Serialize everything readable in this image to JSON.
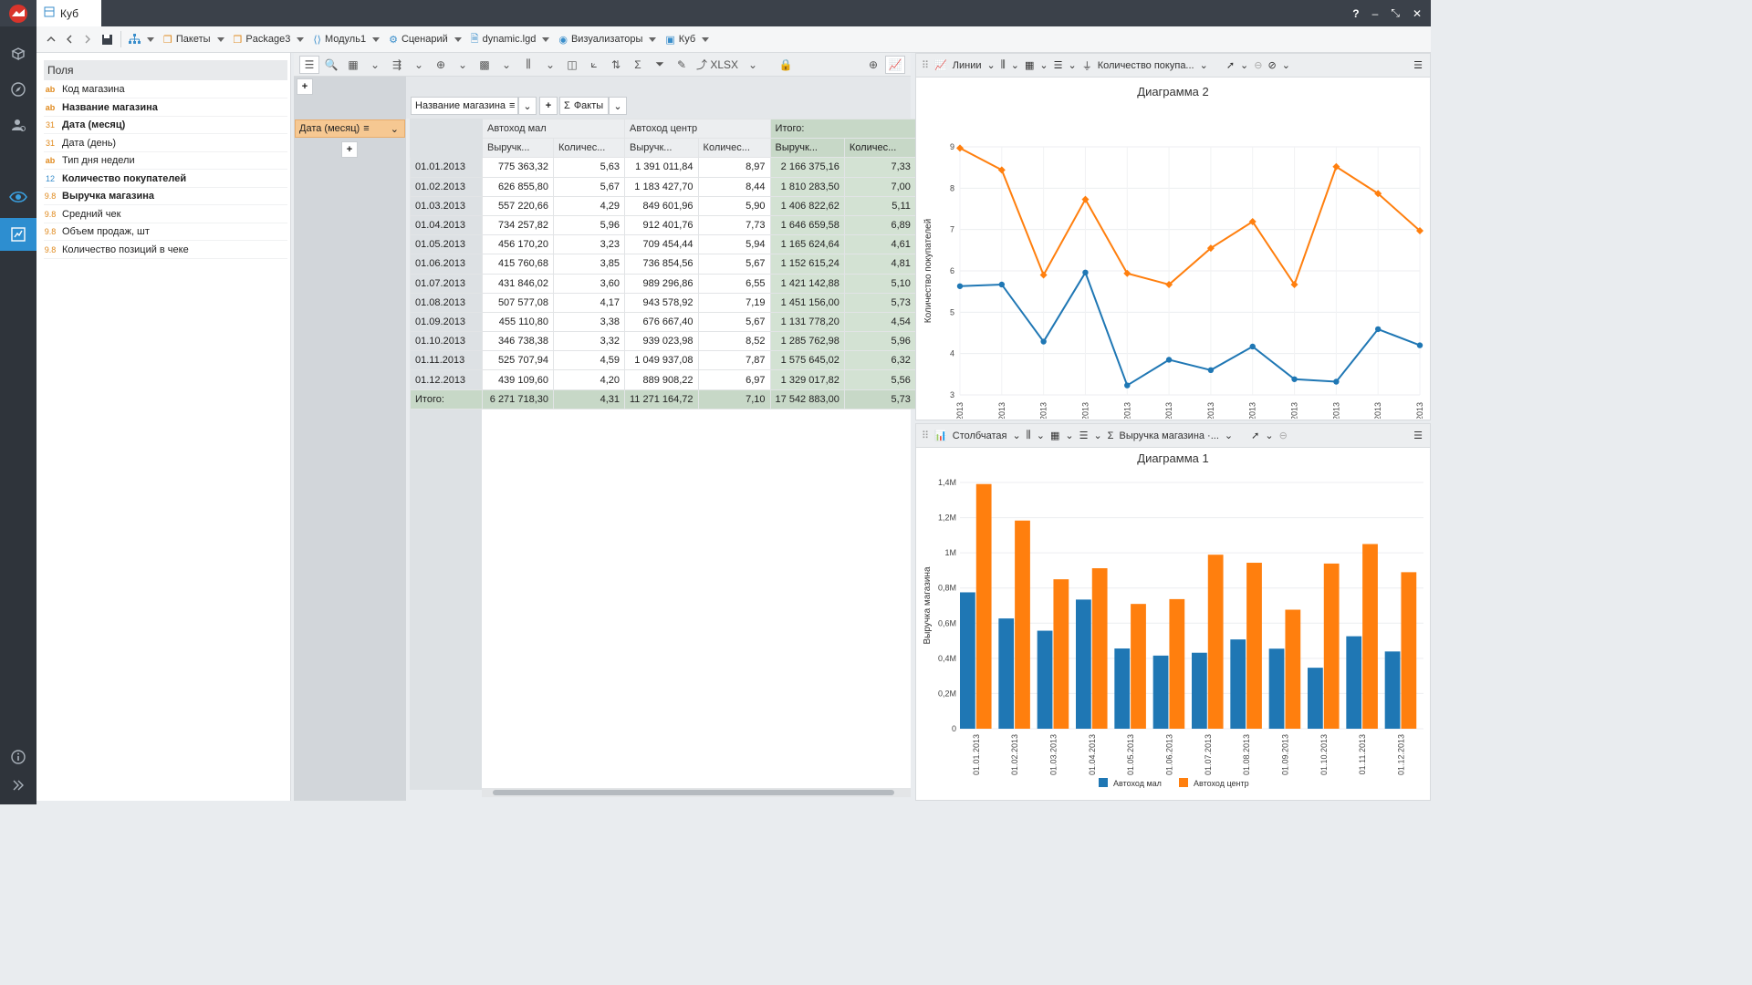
{
  "window": {
    "tab_title": "Куб",
    "help": "?",
    "minimize": "–",
    "restore": "⤡",
    "close": "✕"
  },
  "nav": {
    "items": [
      "Пакеты",
      "Package3",
      "Модуль1",
      "Сценарий",
      "dynamic.lgd",
      "Визуализаторы",
      "Куб"
    ]
  },
  "fields": {
    "title": "Поля",
    "items": [
      {
        "type": "ab",
        "label": "Код магазина",
        "bold": false
      },
      {
        "type": "ab",
        "label": "Название магазина",
        "bold": true
      },
      {
        "type": "31",
        "label": "Дата (месяц)",
        "bold": true
      },
      {
        "type": "31",
        "label": "Дата (день)",
        "bold": false
      },
      {
        "type": "ab",
        "label": "Тип дня недели",
        "bold": false
      },
      {
        "type": "12",
        "label": "Количество покупателей",
        "bold": true
      },
      {
        "type": "9.8",
        "label": "Выручка магазина",
        "bold": true
      },
      {
        "type": "9.8",
        "label": "Средний чек",
        "bold": false
      },
      {
        "type": "9.8",
        "label": "Объем продаж, шт",
        "bold": false
      },
      {
        "type": "9.8",
        "label": "Количество позиций в чеке",
        "bold": false
      }
    ]
  },
  "cube": {
    "xlsx_label": "XLSX",
    "add": "+",
    "col_dim": "Название магазина",
    "facts": "Факты",
    "row_dim": "Дата (месяц)",
    "col_groups": [
      "Автоход мал",
      "Автоход центр",
      "Итого:"
    ],
    "sub_headers": [
      "Выручк...",
      "Количес...",
      "Выручк...",
      "Количес...",
      "Выручк...",
      "Количес..."
    ],
    "rows": [
      [
        "01.01.2013",
        "775 363,32",
        "5,63",
        "1 391 011,84",
        "8,97",
        "2 166 375,16",
        "7,33"
      ],
      [
        "01.02.2013",
        "626 855,80",
        "5,67",
        "1 183 427,70",
        "8,44",
        "1 810 283,50",
        "7,00"
      ],
      [
        "01.03.2013",
        "557 220,66",
        "4,29",
        "849 601,96",
        "5,90",
        "1 406 822,62",
        "5,11"
      ],
      [
        "01.04.2013",
        "734 257,82",
        "5,96",
        "912 401,76",
        "7,73",
        "1 646 659,58",
        "6,89"
      ],
      [
        "01.05.2013",
        "456 170,20",
        "3,23",
        "709 454,44",
        "5,94",
        "1 165 624,64",
        "4,61"
      ],
      [
        "01.06.2013",
        "415 760,68",
        "3,85",
        "736 854,56",
        "5,67",
        "1 152 615,24",
        "4,81"
      ],
      [
        "01.07.2013",
        "431 846,02",
        "3,60",
        "989 296,86",
        "6,55",
        "1 421 142,88",
        "5,10"
      ],
      [
        "01.08.2013",
        "507 577,08",
        "4,17",
        "943 578,92",
        "7,19",
        "1 451 156,00",
        "5,73"
      ],
      [
        "01.09.2013",
        "455 110,80",
        "3,38",
        "676 667,40",
        "5,67",
        "1 131 778,20",
        "4,54"
      ],
      [
        "01.10.2013",
        "346 738,38",
        "3,32",
        "939 023,98",
        "8,52",
        "1 285 762,98",
        "5,96"
      ],
      [
        "01.11.2013",
        "525 707,94",
        "4,59",
        "1 049 937,08",
        "7,87",
        "1 575 645,02",
        "6,32"
      ],
      [
        "01.12.2013",
        "439 109,60",
        "4,20",
        "889 908,22",
        "6,97",
        "1 329 017,82",
        "5,56"
      ]
    ],
    "total_row": [
      "Итого:",
      "6 271 718,30",
      "4,31",
      "11 271 164,72",
      "7,10",
      "17 542 883,00",
      "5,73"
    ]
  },
  "chart_panel_1": {
    "type_label": "Линии",
    "measure_label": "Количество покупа..."
  },
  "chart_panel_2": {
    "type_label": "Столбчатая",
    "measure_label": "Выручка магазина ·..."
  },
  "chart_data": [
    {
      "type": "line",
      "title": "Диаграмма 2",
      "ylabel": "Количество покупателей",
      "xlabel": "",
      "ylim": [
        3,
        9
      ],
      "yticks": [
        "3",
        "4",
        "5",
        "6",
        "7",
        "8",
        "9"
      ],
      "categories": [
        "01.01.2013",
        "01.02.2013",
        "01.03.2013",
        "01.04.2013",
        "01.05.2013",
        "01.06.2013",
        "01.07.2013",
        "01.08.2013",
        "01.09.2013",
        "01.10.2013",
        "01.11.2013",
        "01.12.2013"
      ],
      "series": [
        {
          "name": "Автоход мал",
          "color": "#1f77b4",
          "values": [
            5.63,
            5.67,
            4.29,
            5.96,
            3.23,
            3.85,
            3.6,
            4.17,
            3.38,
            3.32,
            4.59,
            4.2
          ]
        },
        {
          "name": "Автоход центр",
          "color": "#ff7f0e",
          "values": [
            8.97,
            8.44,
            5.9,
            7.73,
            5.94,
            5.67,
            6.55,
            7.19,
            5.67,
            8.52,
            7.87,
            6.97
          ]
        }
      ],
      "legend": "bottom",
      "grid": true
    },
    {
      "type": "bar",
      "title": "Диаграмма 1",
      "ylabel": "Выручка магазина",
      "xlabel": "",
      "ylim": [
        0,
        1400000
      ],
      "yticks": [
        "0",
        "0,2M",
        "0,4M",
        "0,6M",
        "0,8M",
        "1M",
        "1,2M",
        "1,4M"
      ],
      "categories": [
        "01.01.2013",
        "01.02.2013",
        "01.03.2013",
        "01.04.2013",
        "01.05.2013",
        "01.06.2013",
        "01.07.2013",
        "01.08.2013",
        "01.09.2013",
        "01.10.2013",
        "01.11.2013",
        "01.12.2013"
      ],
      "series": [
        {
          "name": "Автоход мал",
          "color": "#1f77b4",
          "values": [
            775363.32,
            626855.8,
            557220.66,
            734257.82,
            456170.2,
            415760.68,
            431846.02,
            507577.08,
            455110.8,
            346738.38,
            525707.94,
            439109.6
          ]
        },
        {
          "name": "Автоход центр",
          "color": "#ff7f0e",
          "values": [
            1391011.84,
            1183427.7,
            849601.96,
            912401.76,
            709454.44,
            736854.56,
            989296.86,
            943578.92,
            676667.4,
            939023.98,
            1049937.08,
            889908.22
          ]
        }
      ],
      "legend": "bottom",
      "grid": true
    }
  ]
}
